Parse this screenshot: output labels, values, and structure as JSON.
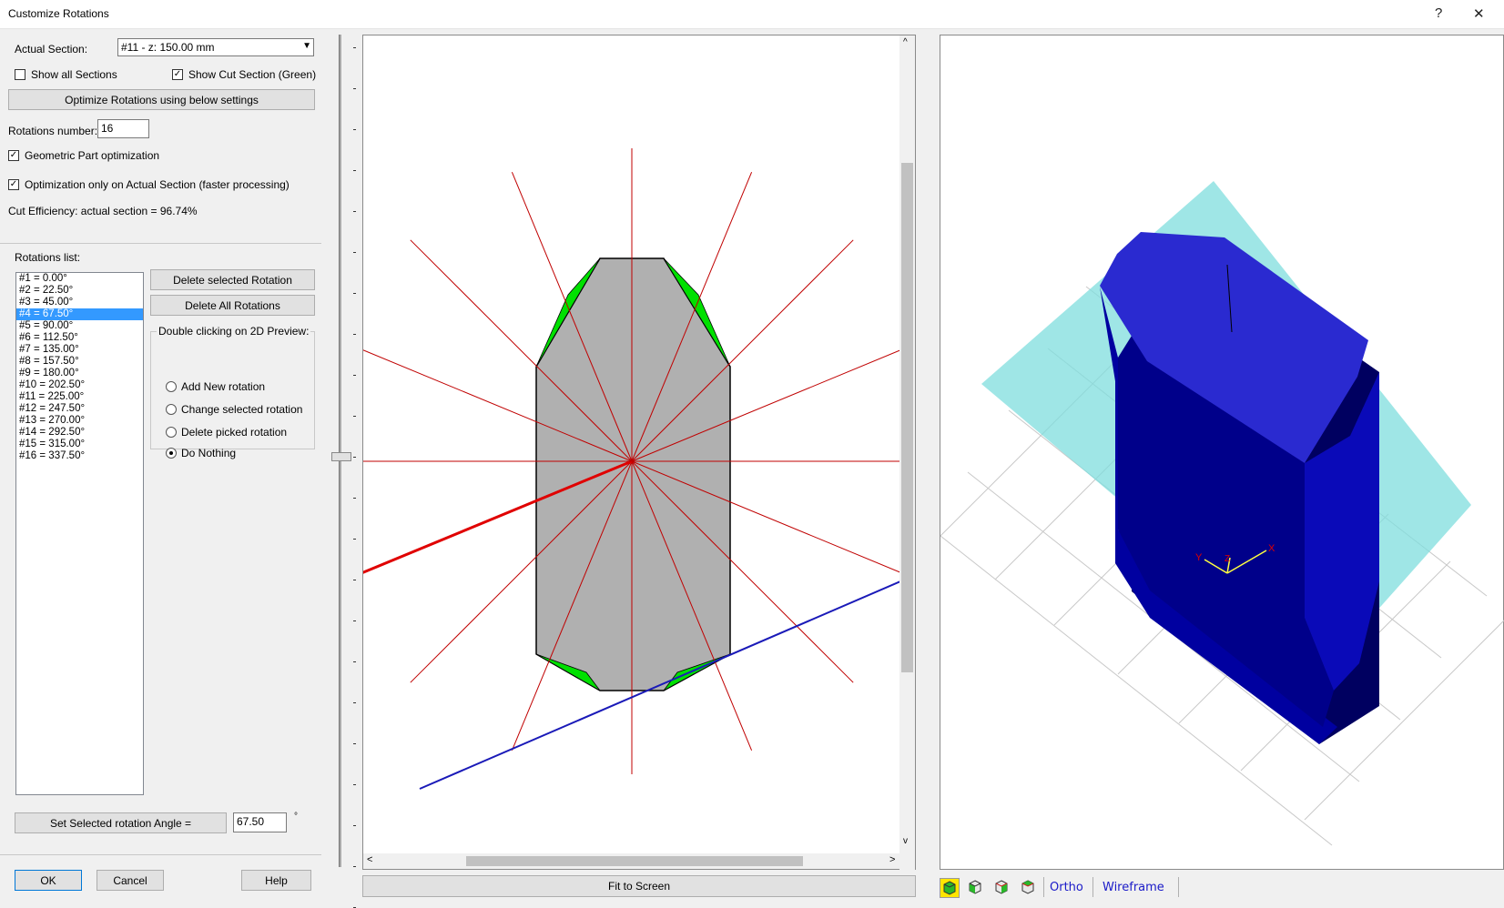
{
  "window": {
    "title": "Customize Rotations",
    "help_glyph": "?",
    "close_glyph": "✕"
  },
  "left": {
    "actual_section_label": "Actual Section:",
    "actual_section_value": "#11 - z: 150.00 mm",
    "show_all_sections_label": "Show all Sections",
    "show_all_sections_checked": false,
    "show_cut_section_label": "Show Cut Section (Green)",
    "show_cut_section_checked": true,
    "optimize_button": "Optimize Rotations using below settings",
    "rotations_number_label": "Rotations number:",
    "rotations_number_value": "16",
    "geometric_opt_label": "Geometric Part optimization",
    "geometric_opt_checked": true,
    "actual_section_only_label": "Optimization only on Actual Section (faster processing)",
    "actual_section_only_checked": true,
    "cut_efficiency": "Cut Efficiency: actual section = 96.74%",
    "rotations_list_label": "Rotations list:",
    "rotations": [
      "#1 = 0.00°",
      "#2 = 22.50°",
      "#3 = 45.00°",
      "#4 = 67.50°",
      "#5 = 90.00°",
      "#6 = 112.50°",
      "#7 = 135.00°",
      "#8 = 157.50°",
      "#9 = 180.00°",
      "#10 = 202.50°",
      "#11 = 225.00°",
      "#12 = 247.50°",
      "#13 = 270.00°",
      "#14 = 292.50°",
      "#15 = 315.00°",
      "#16 = 337.50°"
    ],
    "selected_rotation_index": 3,
    "delete_selected_button": "Delete selected Rotation",
    "delete_all_button": "Delete All Rotations",
    "double_click_group_label": "Double clicking on 2D Preview:",
    "radio_options": [
      "Add New rotation",
      "Change selected  rotation",
      "Delete picked  rotation",
      "Do Nothing"
    ],
    "radio_selected_index": 3,
    "set_angle_button": "Set Selected rotation Angle =",
    "set_angle_value": "67.50",
    "degree_symbol": "°",
    "ok_button": "OK",
    "cancel_button": "Cancel",
    "help_button": "Help"
  },
  "preview": {
    "fit_button": "Fit to Screen",
    "scroll_up_glyph": "^",
    "scroll_down_glyph": "v",
    "scroll_left_glyph": "<",
    "scroll_right_glyph": ">"
  },
  "view3d": {
    "ortho_label": "Ortho",
    "wireframe_label": "Wireframe",
    "tool_icons": [
      "iso-view-icon",
      "front-view-icon",
      "side-view-icon",
      "top-view-icon"
    ],
    "axis_x_label": "X",
    "axis_y_label": "Y",
    "axis_z_label": "Z"
  },
  "colors": {
    "section_fill": "#b0b0b0",
    "cut_green": "#00e000",
    "rotation_line": "#c00000",
    "selected_rotation_line": "#e00000",
    "blue_line": "#1a1ab8",
    "part_blue": "#2a2ad0",
    "cut_plane": "#7fdede",
    "link_blue": "#1a1ac8",
    "selection": "#3399ff"
  }
}
